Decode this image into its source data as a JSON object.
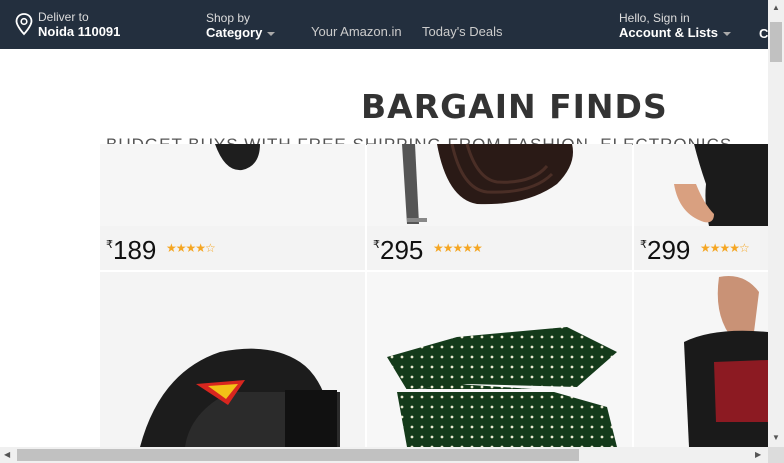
{
  "navbar": {
    "deliver_label": "Deliver to",
    "deliver_location": "Noida 110091",
    "shopby_label": "Shop by",
    "category_label": "Category",
    "your_amazon": "Your Amazon.in",
    "todays_deals": "Today's Deals",
    "greeting": "Hello, Sign in",
    "account_label": "Account & Lists",
    "cart_cut": "C"
  },
  "hero": {
    "title": "BARGAIN FINDS",
    "subtitle": "BUDGET BUYS WITH FREE SHIPPING FROM FASHION, ELECTRONICS"
  },
  "products": [
    {
      "currency": "₹",
      "price": "189",
      "stars": "★★★★☆"
    },
    {
      "currency": "₹",
      "price": "295",
      "stars": "★★★★★"
    },
    {
      "currency": "₹",
      "price": "299",
      "stars": "★★★★☆"
    }
  ],
  "colors": {
    "nav_bg": "#232f3e",
    "star": "#f5a623"
  }
}
